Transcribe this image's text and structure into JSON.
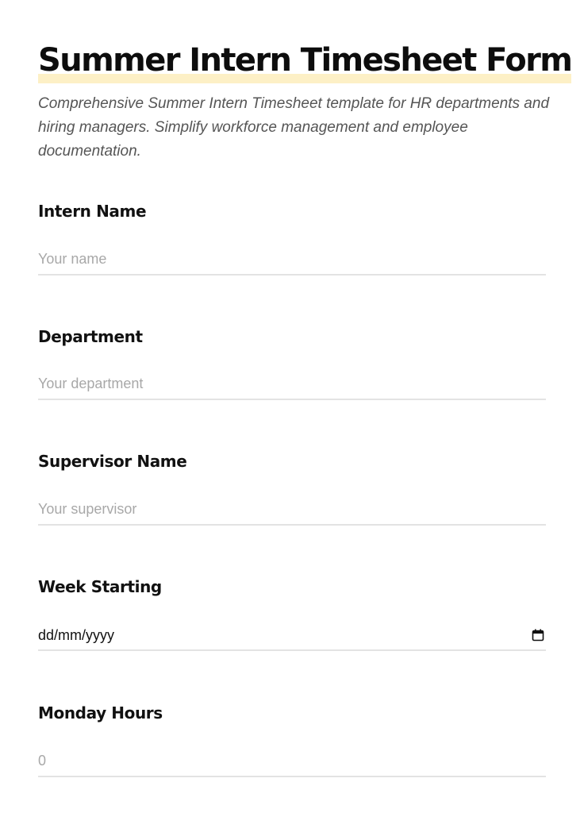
{
  "form": {
    "title": "Summer Intern Timesheet Form",
    "description": "Comprehensive Summer Intern Timesheet template for HR departments and hiring managers. Simplify workforce management and employee documentation."
  },
  "fields": {
    "intern_name": {
      "label": "Intern Name",
      "placeholder": "Your name",
      "value": ""
    },
    "department": {
      "label": "Department",
      "placeholder": "Your department",
      "value": ""
    },
    "supervisor_name": {
      "label": "Supervisor Name",
      "placeholder": "Your supervisor",
      "value": ""
    },
    "week_starting": {
      "label": "Week Starting",
      "placeholder": "dd/mm/yyyy",
      "icon": "calendar-icon"
    },
    "monday_hours": {
      "label": "Monday Hours",
      "placeholder": "0",
      "value": ""
    }
  },
  "colors": {
    "title_highlight": "#fdf0c6",
    "underline": "#e3e3e3",
    "placeholder": "#a8a8a8"
  }
}
